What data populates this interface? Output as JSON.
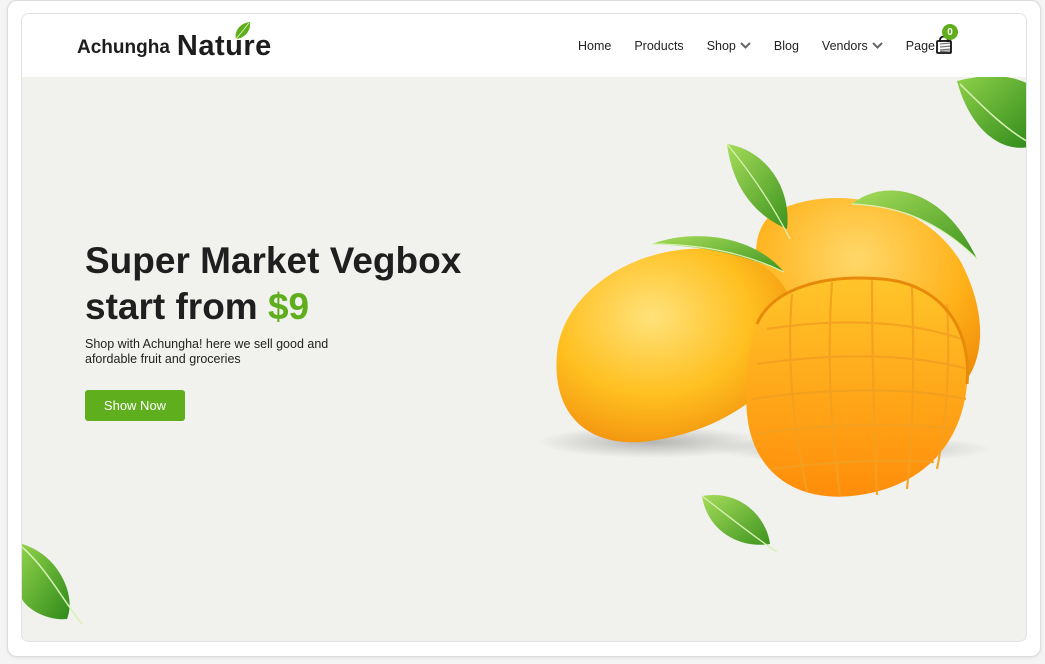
{
  "logo": {
    "small": "Achungha",
    "big": "Nature"
  },
  "nav": {
    "items": [
      {
        "label": "Home",
        "dropdown": false
      },
      {
        "label": "Products",
        "dropdown": false
      },
      {
        "label": "Shop",
        "dropdown": true
      },
      {
        "label": "Blog",
        "dropdown": false
      },
      {
        "label": "Vendors",
        "dropdown": true
      },
      {
        "label": "Page",
        "dropdown": false
      }
    ],
    "cart_count": "0"
  },
  "hero": {
    "title_line1": "Super Market Vegbox",
    "title_line2_prefix": "start from ",
    "price": "$9",
    "description": "Shop with Achungha! here we sell good and afordable fruit and groceries",
    "button_label": "Show Now"
  },
  "colors": {
    "accent": "#5fae1d",
    "hero_bg": "#f1f1ee",
    "text": "#1f1f1f"
  },
  "icons": [
    "leaf-icon",
    "chevron-down-icon",
    "menu-lines-icon",
    "shopping-bag-icon",
    "mango-image"
  ]
}
